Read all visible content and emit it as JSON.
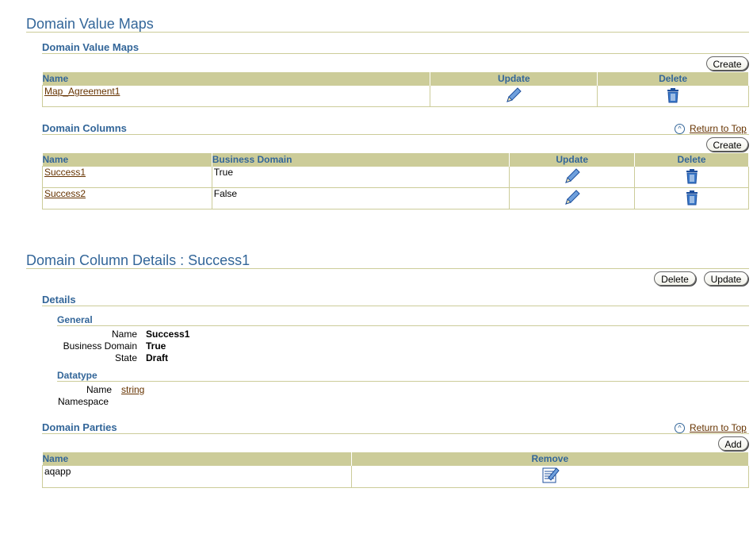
{
  "page": {
    "title": "Domain Value Maps"
  },
  "maps_section": {
    "title": "Domain Value Maps",
    "create_label": "Create",
    "columns": [
      "Name",
      "Update",
      "Delete"
    ],
    "rows": [
      {
        "name": "Map_Agreement1"
      }
    ]
  },
  "columns_section": {
    "title": "Domain Columns",
    "return_to_top": "Return to Top",
    "create_label": "Create",
    "columns": [
      "Name",
      "Business Domain",
      "Update",
      "Delete"
    ],
    "rows": [
      {
        "name": "Success1",
        "business_domain": "True"
      },
      {
        "name": "Success2",
        "business_domain": "False"
      }
    ]
  },
  "details_page": {
    "title": "Domain Column Details : Success1",
    "delete_label": "Delete",
    "update_label": "Update",
    "details_title": "Details",
    "general": {
      "title": "General",
      "name_label": "Name",
      "name_value": "Success1",
      "business_domain_label": "Business Domain",
      "business_domain_value": "True",
      "state_label": "State",
      "state_value": "Draft"
    },
    "datatype": {
      "title": "Datatype",
      "name_label": "Name",
      "name_value": "string",
      "namespace_label": "Namespace"
    }
  },
  "parties_section": {
    "title": "Domain Parties",
    "return_to_top": "Return to Top",
    "add_label": "Add",
    "columns": [
      "Name",
      "Remove"
    ],
    "rows": [
      {
        "name": "aqapp"
      }
    ]
  },
  "icons": {
    "update": "pencil-icon",
    "delete": "trash-icon",
    "remove": "remove-icon",
    "return_to_top": "up-arrow-icon"
  },
  "colors": {
    "header_bg": "#cccc99",
    "heading": "#336699",
    "link": "#663300"
  }
}
